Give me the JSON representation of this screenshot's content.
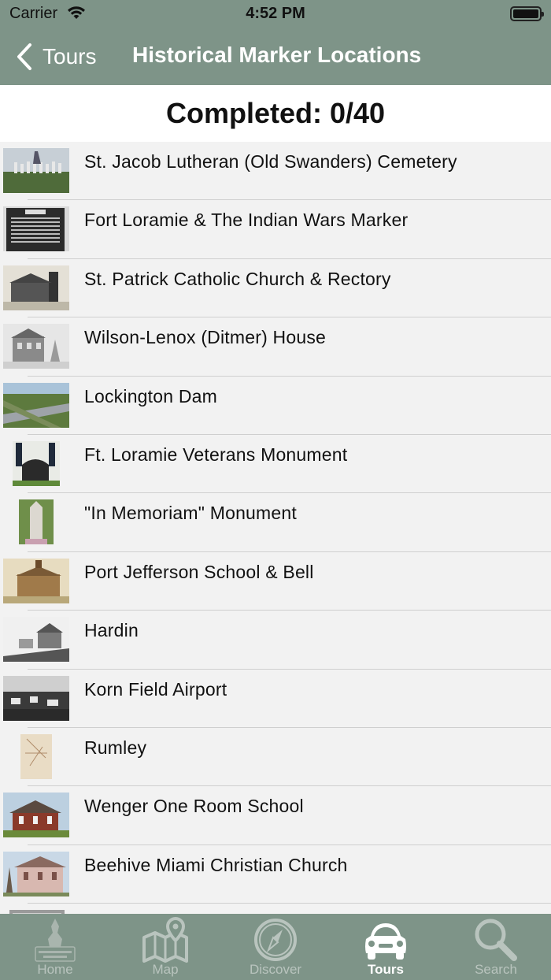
{
  "status_bar": {
    "carrier": "Carrier",
    "time": "4:52 PM"
  },
  "nav": {
    "back_label": "Tours",
    "title": "Historical Marker Locations"
  },
  "progress": {
    "label": "Completed: 0/40"
  },
  "markers": [
    {
      "name": "St. Jacob Lutheran (Old Swanders) Cemetery"
    },
    {
      "name": "Fort Loramie & The Indian Wars Marker"
    },
    {
      "name": "St. Patrick Catholic Church & Rectory"
    },
    {
      "name": "Wilson-Lenox (Ditmer) House"
    },
    {
      "name": "Lockington Dam"
    },
    {
      "name": "Ft. Loramie Veterans Monument"
    },
    {
      "name": "\"In Memoriam\" Monument"
    },
    {
      "name": "Port Jefferson School & Bell"
    },
    {
      "name": "Hardin"
    },
    {
      "name": "Korn Field Airport"
    },
    {
      "name": "Rumley"
    },
    {
      "name": "Wenger One Room School"
    },
    {
      "name": "Beehive Miami Christian Church"
    },
    {
      "name": ""
    }
  ],
  "tabs": [
    {
      "label": "Home",
      "icon": "home-logo-icon"
    },
    {
      "label": "Map",
      "icon": "map-icon"
    },
    {
      "label": "Discover",
      "icon": "compass-icon"
    },
    {
      "label": "Tours",
      "icon": "car-icon",
      "active": true
    },
    {
      "label": "Search",
      "icon": "search-icon"
    }
  ],
  "colors": {
    "bar": "#7e9488",
    "list_bg": "#f2f2f2",
    "tab_inactive": "#b9c4be",
    "tab_active": "#ffffff"
  }
}
